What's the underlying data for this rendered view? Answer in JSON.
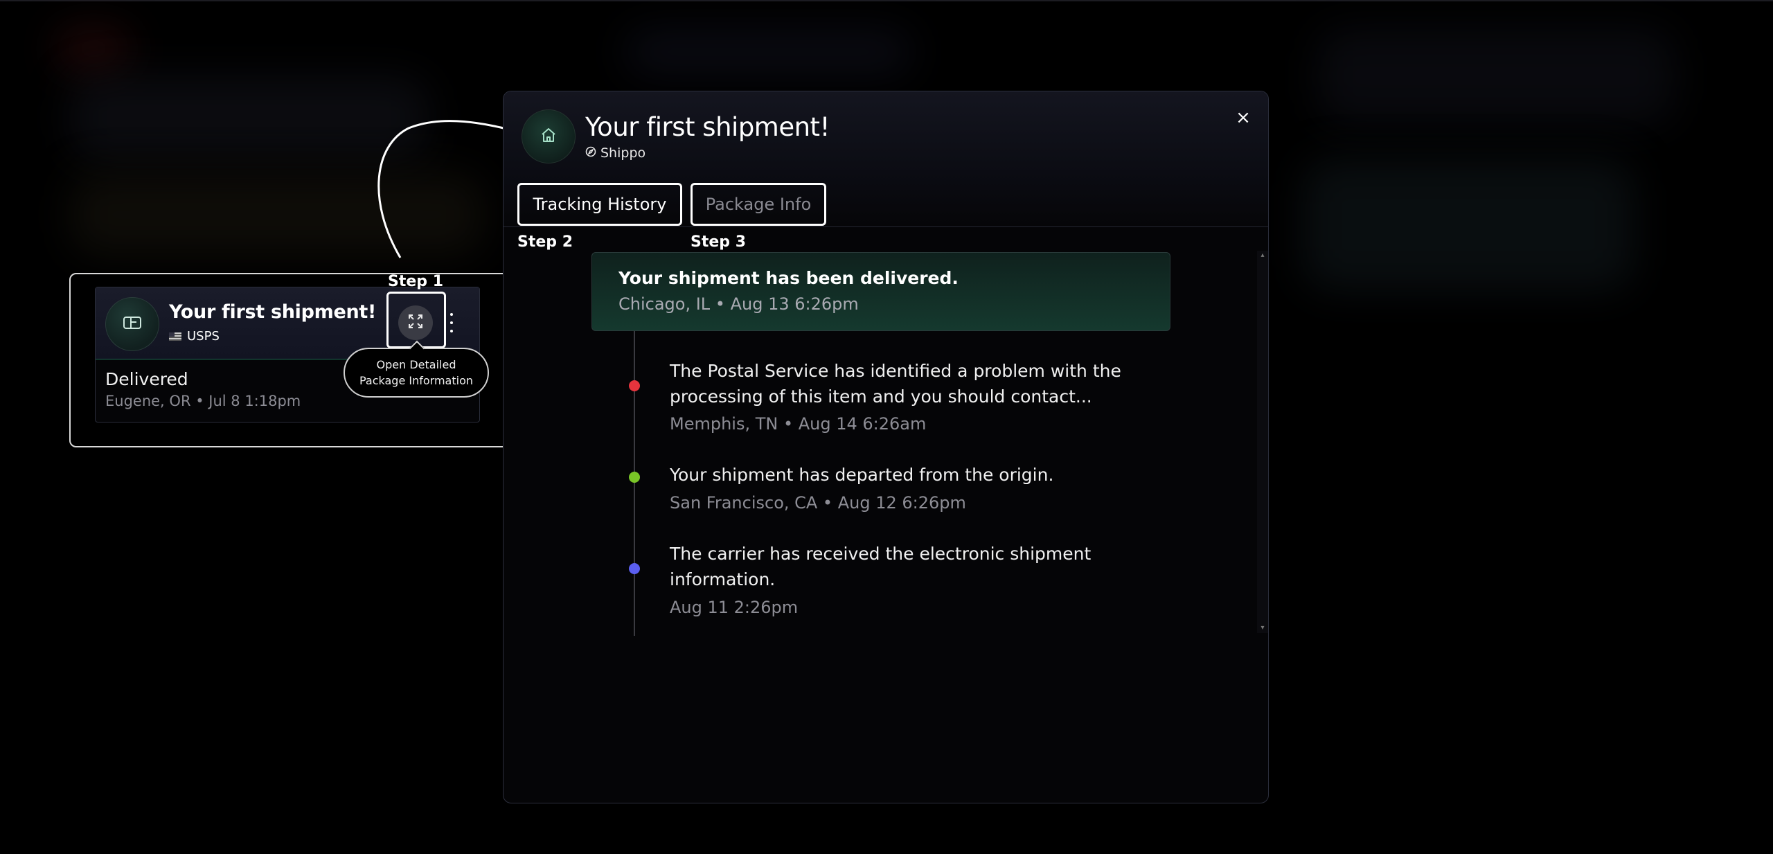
{
  "tutorial": {
    "step1_label": "Step 1",
    "step2_label": "Step 2",
    "step3_label": "Step 3",
    "tooltip_line1": "Open Detailed",
    "tooltip_line2": "Package Information"
  },
  "mini_card": {
    "title": "Your first shipment!",
    "carrier": "USPS",
    "status": "Delivered",
    "location_time": "Eugene, OR • Jul 8 1:18pm",
    "icons": [
      "package-icon",
      "flag-icon",
      "expand-icon",
      "kebab-menu-icon"
    ]
  },
  "modal": {
    "title": "Your first shipment!",
    "org": "Shippo",
    "close_label": "×",
    "tabs": [
      {
        "label": "Tracking History",
        "active": true
      },
      {
        "label": "Package Info",
        "active": false
      }
    ],
    "delivered": {
      "title": "Your shipment has been delivered.",
      "sub": "Chicago, IL • Aug 13 6:26pm"
    },
    "events": [
      {
        "text": "The Postal Service has identified a problem with the processing of this item and you should contact...",
        "meta": "Memphis, TN • Aug 14 6:26am",
        "color": "#e5343d"
      },
      {
        "text": "Your shipment has departed from the origin.",
        "meta": "San Francisco, CA • Aug 12 6:26pm",
        "color": "#79c427"
      },
      {
        "text": "The carrier has received the electronic shipment information.",
        "meta": "Aug 11 2:26pm",
        "color": "#5b5ff0"
      }
    ]
  },
  "colors": {
    "accent_green": "#1f6b55",
    "dot_red": "#e5343d",
    "dot_green": "#79c427",
    "dot_blue": "#5b5ff0"
  }
}
